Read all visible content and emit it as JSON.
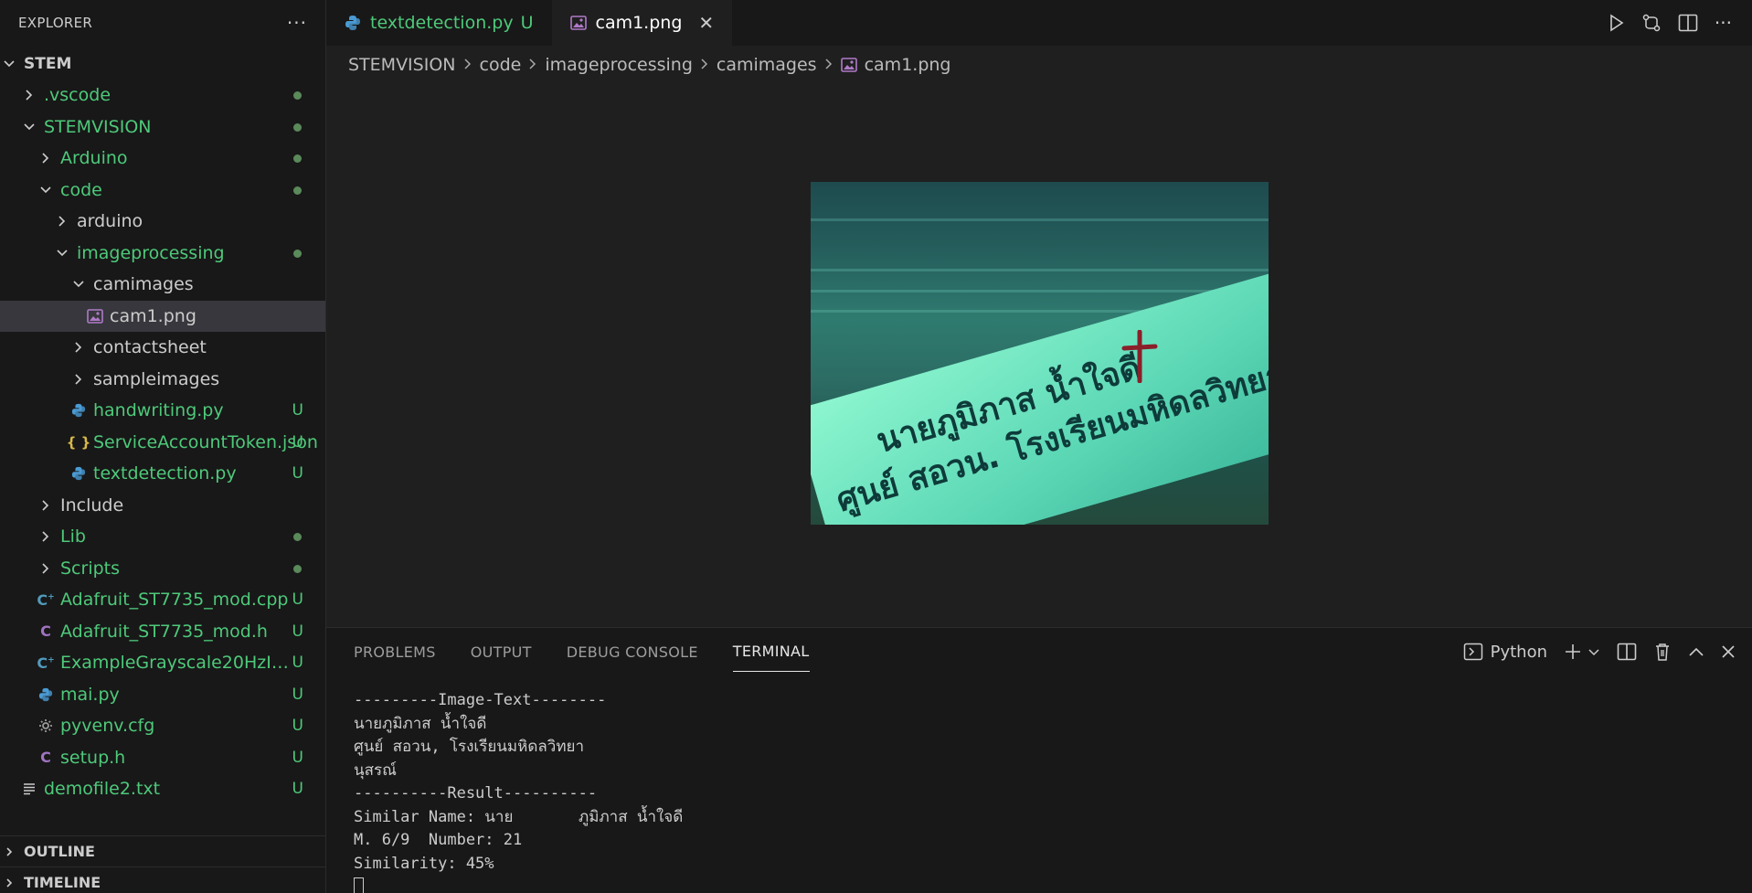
{
  "sidebar": {
    "title": "EXPLORER",
    "more": "···",
    "root": "STEM",
    "items": [
      {
        "label": ".vscode",
        "kind": "folder",
        "indent": 1,
        "expanded": false,
        "status": "dot"
      },
      {
        "label": "STEMVISION",
        "kind": "folder",
        "indent": 1,
        "expanded": true,
        "status": "dot"
      },
      {
        "label": "Arduino",
        "kind": "folder",
        "indent": 2,
        "expanded": false,
        "status": "dot"
      },
      {
        "label": "code",
        "kind": "folder",
        "indent": 2,
        "expanded": true,
        "status": "dot"
      },
      {
        "label": "arduino",
        "kind": "folder",
        "indent": 3,
        "expanded": false,
        "status": "",
        "plain": true
      },
      {
        "label": "imageprocessing",
        "kind": "folder",
        "indent": 3,
        "expanded": true,
        "status": "dot"
      },
      {
        "label": "camimages",
        "kind": "folder",
        "indent": 4,
        "expanded": true,
        "status": "",
        "plain": true
      },
      {
        "label": "cam1.png",
        "kind": "image",
        "indent": 5,
        "status": "",
        "plain": true,
        "selected": true
      },
      {
        "label": "contactsheet",
        "kind": "folder",
        "indent": 4,
        "expanded": false,
        "status": "",
        "plain": true
      },
      {
        "label": "sampleimages",
        "kind": "folder",
        "indent": 4,
        "expanded": false,
        "status": "",
        "plain": true
      },
      {
        "label": "handwriting.py",
        "kind": "python",
        "indent": 4,
        "status": "U"
      },
      {
        "label": "ServiceAccountToken.json",
        "kind": "json",
        "indent": 4,
        "status": "U"
      },
      {
        "label": "textdetection.py",
        "kind": "python",
        "indent": 4,
        "status": "U"
      },
      {
        "label": "Include",
        "kind": "folder",
        "indent": 2,
        "expanded": false,
        "status": "",
        "plain": true
      },
      {
        "label": "Lib",
        "kind": "folder",
        "indent": 2,
        "expanded": false,
        "status": "dot"
      },
      {
        "label": "Scripts",
        "kind": "folder",
        "indent": 2,
        "expanded": false,
        "status": "dot"
      },
      {
        "label": "Adafruit_ST7735_mod.cpp",
        "kind": "cpp",
        "indent": 2,
        "status": "U"
      },
      {
        "label": "Adafruit_ST7735_mod.h",
        "kind": "c",
        "indent": 2,
        "status": "U"
      },
      {
        "label": "ExampleGrayscale20HzInte...",
        "kind": "cpp",
        "indent": 2,
        "status": "U"
      },
      {
        "label": "mai.py",
        "kind": "python",
        "indent": 2,
        "status": "U"
      },
      {
        "label": "pyvenv.cfg",
        "kind": "gear",
        "indent": 2,
        "status": "U"
      },
      {
        "label": "setup.h",
        "kind": "c",
        "indent": 2,
        "status": "U"
      },
      {
        "label": "demofile2.txt",
        "kind": "text",
        "indent": 1,
        "status": "U"
      }
    ],
    "outline": "OUTLINE",
    "timeline": "TIMELINE"
  },
  "tabs": [
    {
      "label": "textdetection.py",
      "badge": "U",
      "active": false
    },
    {
      "label": "cam1.png",
      "close": "✕",
      "active": true
    }
  ],
  "breadcrumb": [
    "STEMVISION",
    "code",
    "imageprocessing",
    "camimages",
    "cam1.png"
  ],
  "preview": {
    "line1": "นายภูมิภาส น้ำใจดี",
    "line2": "ศูนย์ สอวน. โรงเรียนมหิดลวิทยา"
  },
  "panel": {
    "tabs": [
      "PROBLEMS",
      "OUTPUT",
      "DEBUG CONSOLE",
      "TERMINAL"
    ],
    "active_tab": "TERMINAL",
    "shell": "Python",
    "terminal_lines": [
      "---------Image-Text--------",
      "นายภูมิภาส น้ำใจดี",
      "ศูนย์ สอวน, โรงเรียนมหิดลวิทยา",
      "นุสรณ์",
      "----------Result----------",
      "Similar Name: นาย       ภูมิภาส น้ำใจดี",
      "M. 6/9  Number: 21",
      "Similarity: 45%"
    ]
  },
  "colors": {
    "git_untracked": "#4ec97a",
    "sidebar_bg": "#181818",
    "editor_bg": "#1f1f1f",
    "selection": "#37373d"
  }
}
